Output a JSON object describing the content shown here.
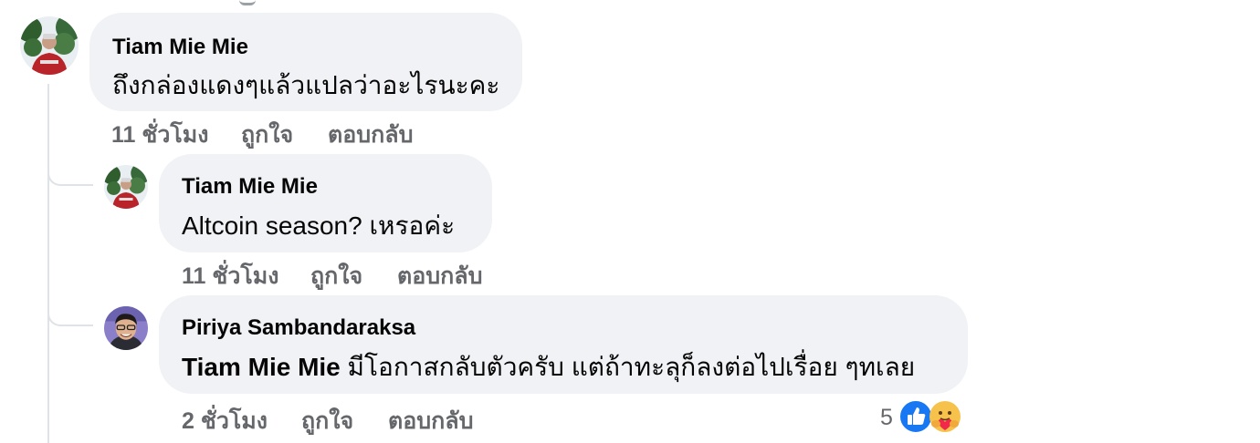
{
  "comments": [
    {
      "author": "Tiam Mie Mie",
      "text": "ถึงกล่องแดงๆแล้วแปลว่าอะไรนะคะ",
      "time": "11 ชั่วโมง",
      "like_label": "ถูกใจ",
      "reply_label": "ตอบกลับ"
    },
    {
      "author": "Tiam Mie Mie",
      "text": "Altcoin season? เหรอค่ะ",
      "time": "11 ชั่วโมง",
      "like_label": "ถูกใจ",
      "reply_label": "ตอบกลับ"
    },
    {
      "author": "Piriya Sambandaraksa",
      "mention": "Tiam Mie Mie",
      "text": " มีโอกาสกลับตัวครับ แต่ถ้าทะลุก็ลงต่อไปเรื่อย ๆทเลย",
      "time": "2 ชั่วโมง",
      "like_label": "ถูกใจ",
      "reply_label": "ตอบกลับ",
      "reactions": {
        "count": "5",
        "icons": [
          "like-icon",
          "care-icon"
        ],
        "like_color": "#1877f2"
      }
    }
  ]
}
